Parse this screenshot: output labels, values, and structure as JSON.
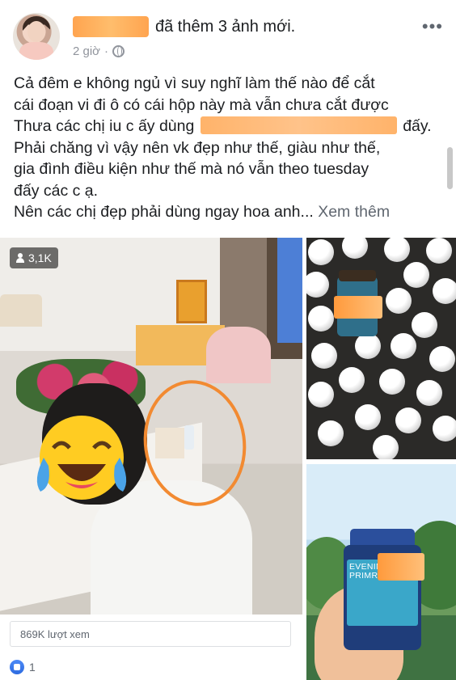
{
  "post": {
    "action_text": "đã thêm 3 ảnh mới.",
    "time": "2 giờ",
    "more_glyph": "•••",
    "lines": [
      "Cả đêm e không ngủ vì suy nghĩ làm thế nào để cắt",
      "cái đoạn vi đi ô có cái hộp này mà vẫn chưa cắt được",
      "Thưa các chị iu c ấy dùng",
      "đấy.",
      "Phải chăng vì vậy nên vk đẹp như thế, giàu như thế,",
      "gia đình điều kiện như thế mà nó vẫn theo tuesday",
      "đấy các c ạ.",
      "Nên các chị đẹp phải dùng ngay hoa anh..."
    ],
    "see_more": "Xem thêm"
  },
  "media": {
    "view_count": "3,1K",
    "emoji": "😂",
    "views_text": "869K lượt xem",
    "reaction_count": "1"
  },
  "product": {
    "label_lines": [
      "EVENING",
      "PRIMROSE OI"
    ]
  },
  "colors": {
    "redaction": "#ff9a3c",
    "accent": "#1877f2"
  }
}
